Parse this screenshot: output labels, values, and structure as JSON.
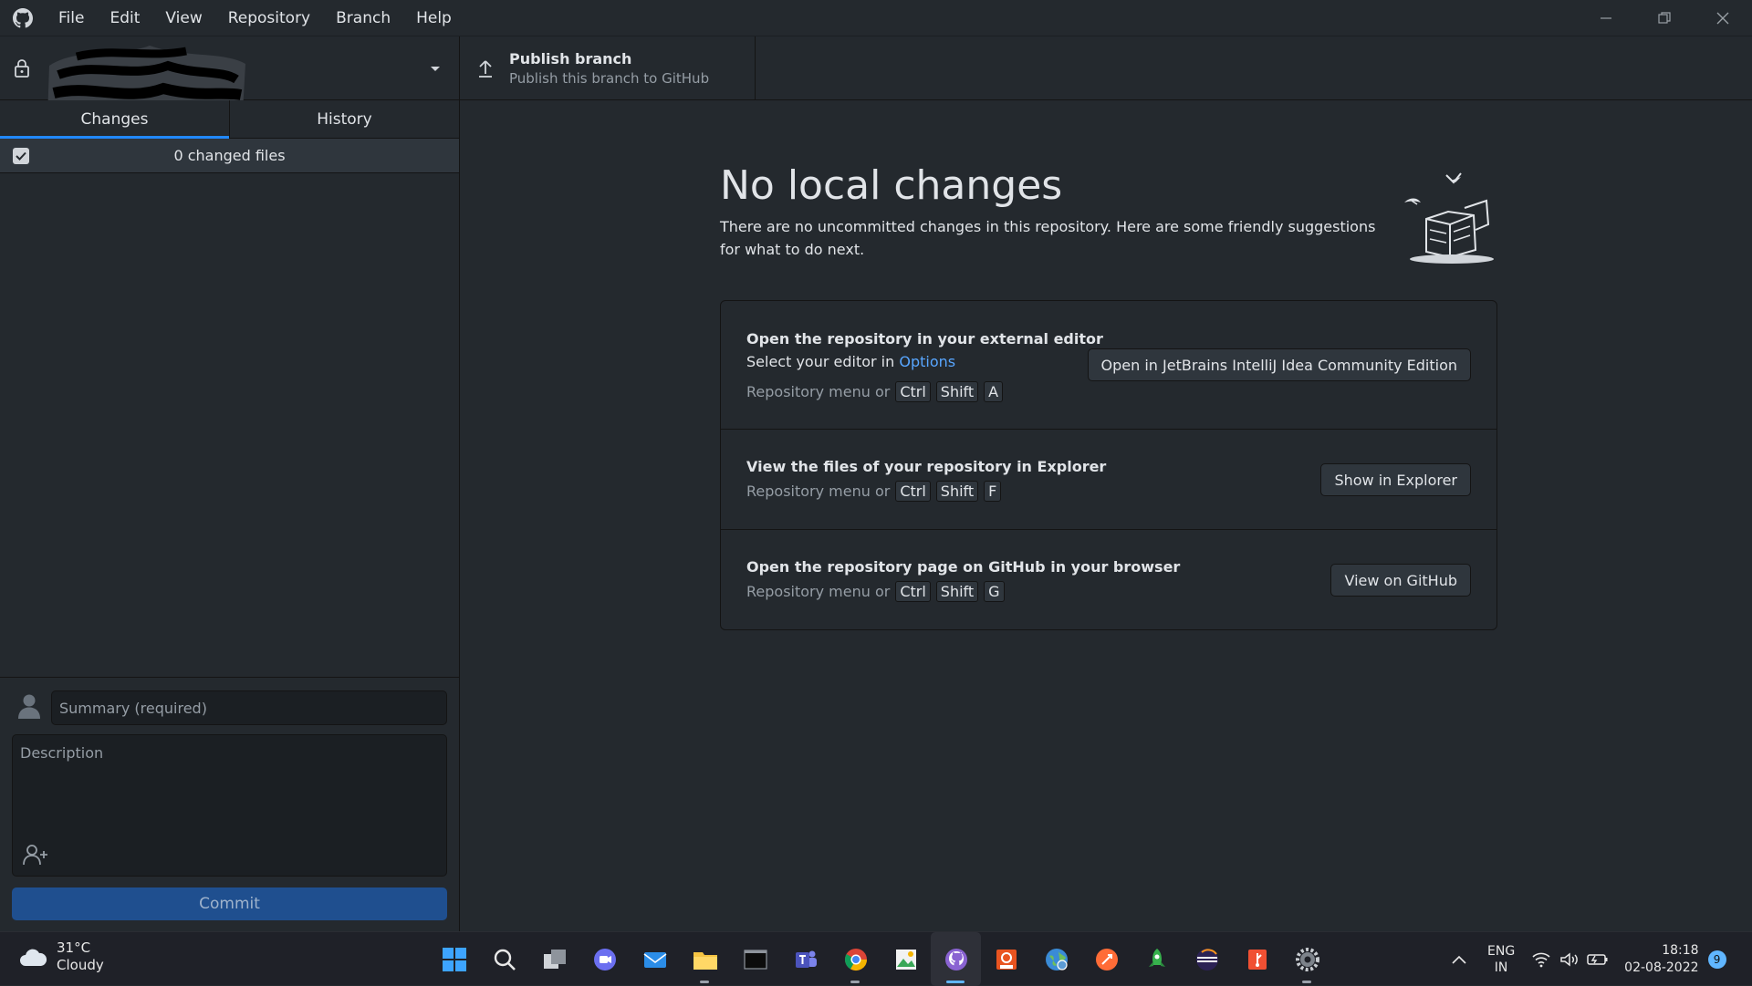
{
  "menu": [
    "File",
    "Edit",
    "View",
    "Repository",
    "Branch",
    "Help"
  ],
  "toolbar": {
    "publish_title": "Publish branch",
    "publish_sub": "Publish this branch to GitHub"
  },
  "sidebar": {
    "tabs": [
      {
        "label": "Changes",
        "active": true
      },
      {
        "label": "History",
        "active": false
      }
    ],
    "files_count": "0 changed files",
    "summary_placeholder": "Summary (required)",
    "description_placeholder": "Description",
    "commit_label": "Commit"
  },
  "main": {
    "title": "No local changes",
    "description": "There are no uncommitted changes in this repository. Here are some friendly suggestions for what to do next.",
    "actions": [
      {
        "title": "Open the repository in your external editor",
        "subtitle_prefix": "Select your editor in ",
        "subtitle_link": "Options",
        "shortcut_prefix": "Repository menu or",
        "keys": [
          "Ctrl",
          "Shift",
          "A"
        ],
        "button": "Open in JetBrains IntelliJ Idea Community Edition"
      },
      {
        "title": "View the files of your repository in Explorer",
        "shortcut_prefix": "Repository menu or",
        "keys": [
          "Ctrl",
          "Shift",
          "F"
        ],
        "button": "Show in Explorer"
      },
      {
        "title": "Open the repository page on GitHub in your browser",
        "shortcut_prefix": "Repository menu or",
        "keys": [
          "Ctrl",
          "Shift",
          "G"
        ],
        "button": "View on GitHub"
      }
    ]
  },
  "taskbar": {
    "temperature": "31°C",
    "condition": "Cloudy",
    "lang_1": "ENG",
    "lang_2": "IN",
    "time": "18:18",
    "date": "02-08-2022",
    "notifications": "9",
    "apps": [
      "windows-start-icon",
      "search-icon",
      "task-view-icon",
      "chat-icon",
      "mail-icon",
      "file-explorer-icon",
      "terminal-icon",
      "teams-icon",
      "chrome-icon",
      "image-editor-icon",
      "github-desktop-icon",
      "ubuntu-icon",
      "globe-app-icon",
      "postman-icon",
      "rocket-app-icon",
      "eclipse-icon",
      "git-icon",
      "settings-icon"
    ]
  }
}
